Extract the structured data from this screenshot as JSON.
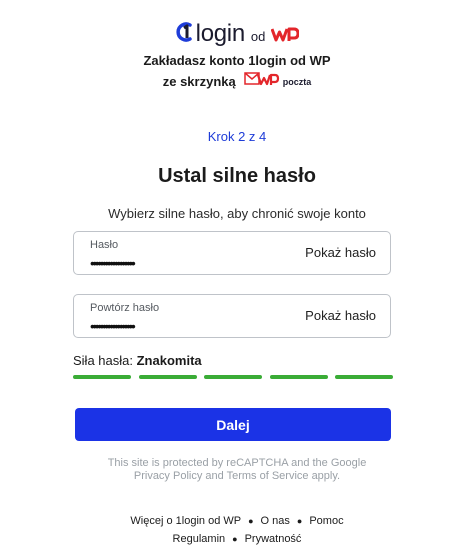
{
  "brand": {
    "onelogin_word": "login",
    "od": "od",
    "icons": [
      "onelogin-logo-icon",
      "wp-logo-icon",
      "envelope-wp-icon"
    ]
  },
  "header": {
    "line1": "Zakładasz konto 1login od WP",
    "line2_prefix": "ze skrzynką",
    "poczta_label": "poczta"
  },
  "step": "Krok 2 z 4",
  "title": "Ustal silne hasło",
  "subtitle": "Wybierz silne hasło, aby chronić swoje konto",
  "form": {
    "password": {
      "label": "Hasło",
      "value": "••••••••••••••••••",
      "toggle": "Pokaż hasło"
    },
    "repeat": {
      "label": "Powtórz hasło",
      "value": "••••••••••••••••••",
      "toggle": "Pokaż hasło"
    }
  },
  "strength": {
    "label": "Siła hasła:",
    "value": "Znakomita",
    "level": 5,
    "max": 5,
    "color": "#3aac36"
  },
  "submit": "Dalej",
  "captcha": {
    "line1": "This site is protected by reCAPTCHA and the Google",
    "line2": "Privacy Policy and Terms of Service apply."
  },
  "footer": {
    "links_row1": [
      "Więcej o 1login od WP",
      "O nas",
      "Pomoc"
    ],
    "links_row2": [
      "Regulamin",
      "Prywatność"
    ]
  },
  "colors": {
    "accent": "#1b33e6",
    "step": "#1e3cd8",
    "wp_red": "#e3262b",
    "strength": "#3aac36"
  }
}
